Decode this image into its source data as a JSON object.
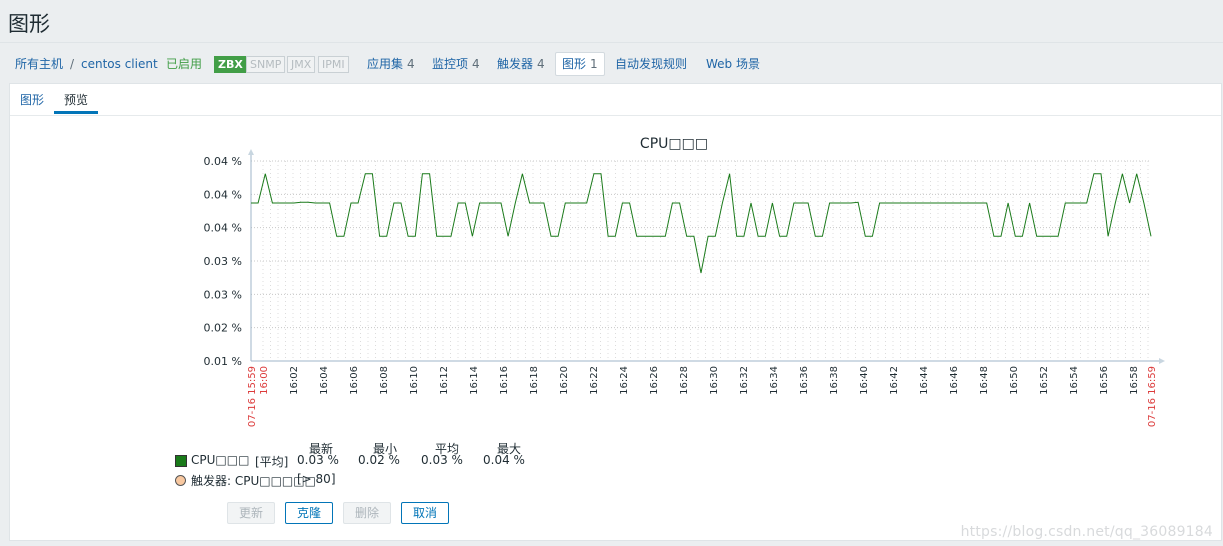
{
  "page_title": "图形",
  "breadcrumb": {
    "all_hosts": "所有主机",
    "separator": "/",
    "host": "centos client",
    "status": "已启用",
    "badges": [
      "ZBX",
      "SNMP",
      "JMX",
      "IPMI"
    ],
    "items": [
      {
        "label": "应用集",
        "count": "4"
      },
      {
        "label": "监控项",
        "count": "4"
      },
      {
        "label": "触发器",
        "count": "4"
      },
      {
        "label": "图形",
        "count": "1"
      },
      {
        "label": "自动发现规则",
        "count": ""
      },
      {
        "label": "Web 场景",
        "count": ""
      }
    ]
  },
  "tabs": [
    "图形",
    "预览"
  ],
  "graph": {
    "title": "CPU□□□"
  },
  "chart_data": {
    "type": "line",
    "title": "CPU□□□",
    "y_tick_labels": [
      "0.04 %",
      "0.04 %",
      "0.04 %",
      "0.03 %",
      "0.03 %",
      "0.02 %",
      "0.01 %"
    ],
    "ylim": [
      0.01,
      0.04
    ],
    "x_tick_labels": [
      "07-16 15:59",
      "16:00",
      "16:02",
      "16:04",
      "16:06",
      "16:08",
      "16:10",
      "16:12",
      "16:14",
      "16:16",
      "16:18",
      "16:20",
      "16:22",
      "16:24",
      "16:26",
      "16:28",
      "16:30",
      "16:32",
      "16:34",
      "16:36",
      "16:38",
      "16:40",
      "16:42",
      "16:44",
      "16:46",
      "16:48",
      "16:50",
      "16:52",
      "16:54",
      "16:56",
      "16:58",
      "07-16 16:59"
    ],
    "grid": true,
    "line_color": "#1a7a1a",
    "series": [
      {
        "name": "CPU□□□",
        "y": [
          0.0337,
          0.0337,
          0.0381,
          0.0337,
          0.0337,
          0.0337,
          0.0337,
          0.0338,
          0.0338,
          0.0337,
          0.0337,
          0.0337,
          0.0287,
          0.0287,
          0.0337,
          0.0337,
          0.0381,
          0.0381,
          0.0287,
          0.0287,
          0.0337,
          0.0337,
          0.0287,
          0.0287,
          0.0381,
          0.0381,
          0.0287,
          0.0287,
          0.0287,
          0.0337,
          0.0337,
          0.0287,
          0.0337,
          0.0337,
          0.0337,
          0.0337,
          0.0287,
          0.0337,
          0.0381,
          0.0337,
          0.0337,
          0.0337,
          0.0287,
          0.0287,
          0.0337,
          0.0337,
          0.0337,
          0.0337,
          0.0381,
          0.0381,
          0.0287,
          0.0287,
          0.0337,
          0.0337,
          0.0287,
          0.0287,
          0.0287,
          0.0287,
          0.0287,
          0.0337,
          0.0337,
          0.0287,
          0.0287,
          0.0232,
          0.0287,
          0.0287,
          0.0337,
          0.0381,
          0.0287,
          0.0287,
          0.0337,
          0.0287,
          0.0287,
          0.0337,
          0.0287,
          0.0287,
          0.0337,
          0.0337,
          0.0337,
          0.0287,
          0.0287,
          0.0337,
          0.0337,
          0.0337,
          0.0337,
          0.0338,
          0.0287,
          0.0287,
          0.0337,
          0.0337,
          0.0337,
          0.0337,
          0.0337,
          0.0337,
          0.0337,
          0.0337,
          0.0337,
          0.0337,
          0.0337,
          0.0337,
          0.0337,
          0.0337,
          0.0337,
          0.0337,
          0.0287,
          0.0287,
          0.0337,
          0.0287,
          0.0287,
          0.0337,
          0.0287,
          0.0287,
          0.0287,
          0.0287,
          0.0337,
          0.0337,
          0.0337,
          0.0337,
          0.0381,
          0.0381,
          0.0287,
          0.0337,
          0.0381,
          0.0337,
          0.0381,
          0.0337,
          0.0287
        ]
      }
    ]
  },
  "legend": {
    "stat_headers": [
      "最新",
      "最小",
      "平均",
      "最大"
    ],
    "item_name": "CPU□□□",
    "item_func": "[平均]",
    "stats": [
      "0.03 %",
      "0.02 %",
      "0.03 %",
      "0.04 %"
    ],
    "trigger_name": "触发器: CPU□□□□□",
    "trigger_cond": "[> 80]",
    "item_color": "#1a7a1a",
    "trigger_color": "#f8c8a0"
  },
  "buttons": {
    "update": "更新",
    "clone": "克隆",
    "delete": "删除",
    "cancel": "取消"
  },
  "watermark": "https://blog.csdn.net/qq_36089184"
}
